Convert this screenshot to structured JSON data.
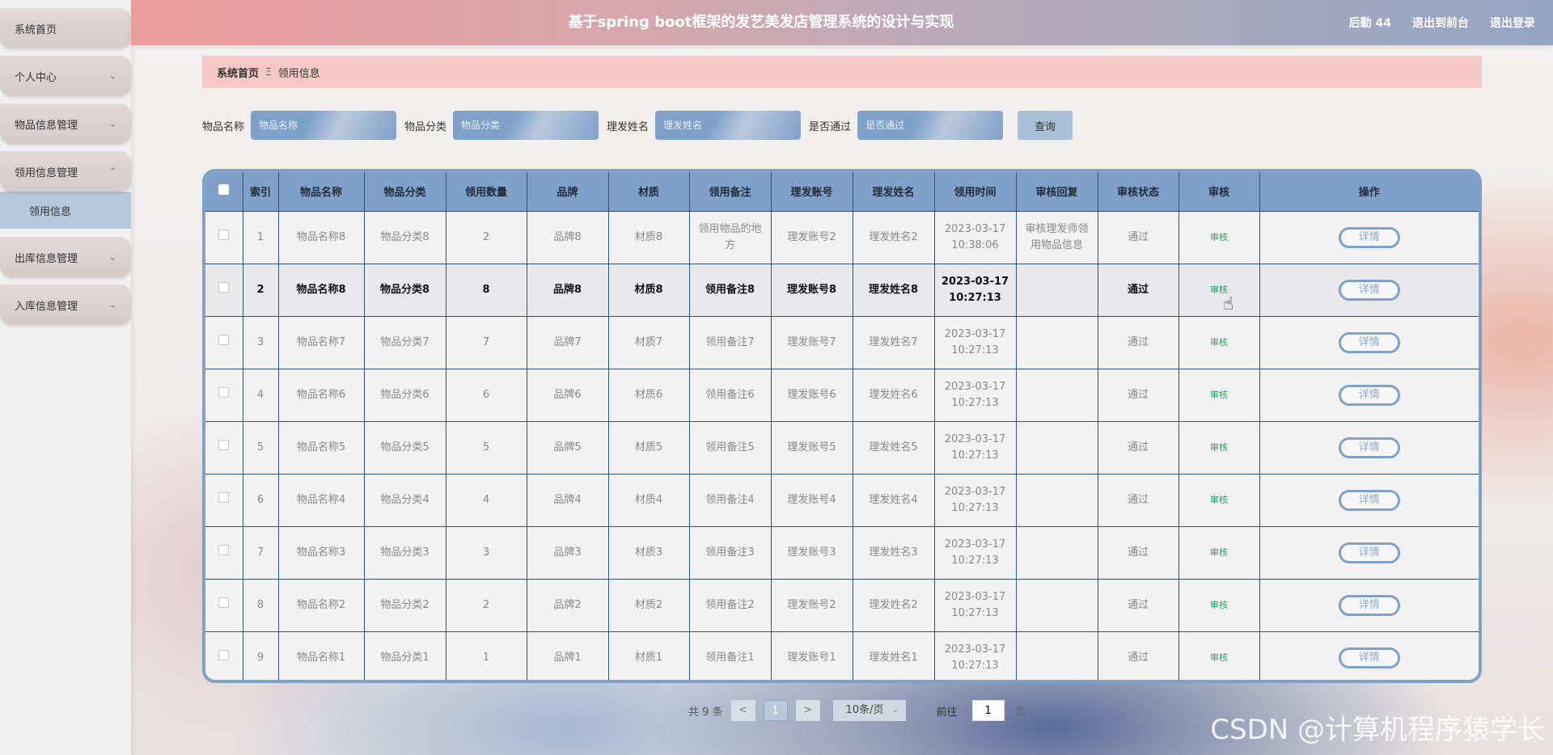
{
  "sidebar": {
    "items": [
      {
        "label": "系统首页",
        "chevron": ""
      },
      {
        "label": "个人中心",
        "chevron": "⌄"
      },
      {
        "label": "物品信息管理",
        "chevron": "⌄"
      },
      {
        "label": "领用信息管理",
        "chevron": "⌃"
      },
      {
        "label": "领用信息"
      },
      {
        "label": "出库信息管理",
        "chevron": "⌄"
      },
      {
        "label": "入库信息管理",
        "chevron": "⌄"
      }
    ]
  },
  "header": {
    "title": "基于spring boot框架的发艺美发店管理系统的设计与实现",
    "user": "后勤 44",
    "to_front": "退出到前台",
    "logout": "退出登录"
  },
  "breadcrumb": {
    "home": "系统首页",
    "separator": "Ξ",
    "current": "领用信息"
  },
  "search": {
    "fields": [
      {
        "label": "物品名称",
        "placeholder": "物品名称"
      },
      {
        "label": "物品分类",
        "placeholder": "物品分类"
      },
      {
        "label": "理发姓名",
        "placeholder": "理发姓名"
      },
      {
        "label": "是否通过",
        "placeholder": "是否通过"
      }
    ],
    "button": "查询"
  },
  "table": {
    "headers": [
      "索引",
      "物品名称",
      "物品分类",
      "领用数量",
      "品牌",
      "材质",
      "领用备注",
      "理发账号",
      "理发姓名",
      "领用时间",
      "审核回复",
      "审核状态",
      "审核",
      "操作"
    ],
    "audit_label": "审核",
    "detail_label": "详情",
    "rows": [
      {
        "idx": "1",
        "name": "物品名称8",
        "cat": "物品分类8",
        "qty": "2",
        "brand": "品牌8",
        "mat": "材质8",
        "note": "领用物品的地方",
        "acct": "理发账号2",
        "person": "理发姓名2",
        "time": "2023-03-17 10:38:06",
        "reply": "审核理发师领用物品信息",
        "status": "通过"
      },
      {
        "idx": "2",
        "name": "物品名称8",
        "cat": "物品分类8",
        "qty": "8",
        "brand": "品牌8",
        "mat": "材质8",
        "note": "领用备注8",
        "acct": "理发账号8",
        "person": "理发姓名8",
        "time": "2023-03-17 10:27:13",
        "reply": "",
        "status": "通过"
      },
      {
        "idx": "3",
        "name": "物品名称7",
        "cat": "物品分类7",
        "qty": "7",
        "brand": "品牌7",
        "mat": "材质7",
        "note": "领用备注7",
        "acct": "理发账号7",
        "person": "理发姓名7",
        "time": "2023-03-17 10:27:13",
        "reply": "",
        "status": "通过"
      },
      {
        "idx": "4",
        "name": "物品名称6",
        "cat": "物品分类6",
        "qty": "6",
        "brand": "品牌6",
        "mat": "材质6",
        "note": "领用备注6",
        "acct": "理发账号6",
        "person": "理发姓名6",
        "time": "2023-03-17 10:27:13",
        "reply": "",
        "status": "通过"
      },
      {
        "idx": "5",
        "name": "物品名称5",
        "cat": "物品分类5",
        "qty": "5",
        "brand": "品牌5",
        "mat": "材质5",
        "note": "领用备注5",
        "acct": "理发账号5",
        "person": "理发姓名5",
        "time": "2023-03-17 10:27:13",
        "reply": "",
        "status": "通过"
      },
      {
        "idx": "6",
        "name": "物品名称4",
        "cat": "物品分类4",
        "qty": "4",
        "brand": "品牌4",
        "mat": "材质4",
        "note": "领用备注4",
        "acct": "理发账号4",
        "person": "理发姓名4",
        "time": "2023-03-17 10:27:13",
        "reply": "",
        "status": "通过"
      },
      {
        "idx": "7",
        "name": "物品名称3",
        "cat": "物品分类3",
        "qty": "3",
        "brand": "品牌3",
        "mat": "材质3",
        "note": "领用备注3",
        "acct": "理发账号3",
        "person": "理发姓名3",
        "time": "2023-03-17 10:27:13",
        "reply": "",
        "status": "通过"
      },
      {
        "idx": "8",
        "name": "物品名称2",
        "cat": "物品分类2",
        "qty": "2",
        "brand": "品牌2",
        "mat": "材质2",
        "note": "领用备注2",
        "acct": "理发账号2",
        "person": "理发姓名2",
        "time": "2023-03-17 10:27:13",
        "reply": "",
        "status": "通过"
      },
      {
        "idx": "9",
        "name": "物品名称1",
        "cat": "物品分类1",
        "qty": "1",
        "brand": "品牌1",
        "mat": "材质1",
        "note": "领用备注1",
        "acct": "理发账号1",
        "person": "理发姓名1",
        "time": "2023-03-17 10:27:13",
        "reply": "",
        "status": "通过"
      }
    ]
  },
  "pager": {
    "total": "共 9 条",
    "prev": "<",
    "current": "1",
    "next": ">",
    "page_size": "10条/页",
    "goto_label": "前往",
    "goto_value": "1",
    "page_word": "页"
  },
  "watermark": "CSDN @计算机程序猿学长",
  "colors": {
    "accent_blue": "#7fa1c9",
    "breadcrumb_pink": "#f4c9c7",
    "audit_green": "#23a06b"
  }
}
